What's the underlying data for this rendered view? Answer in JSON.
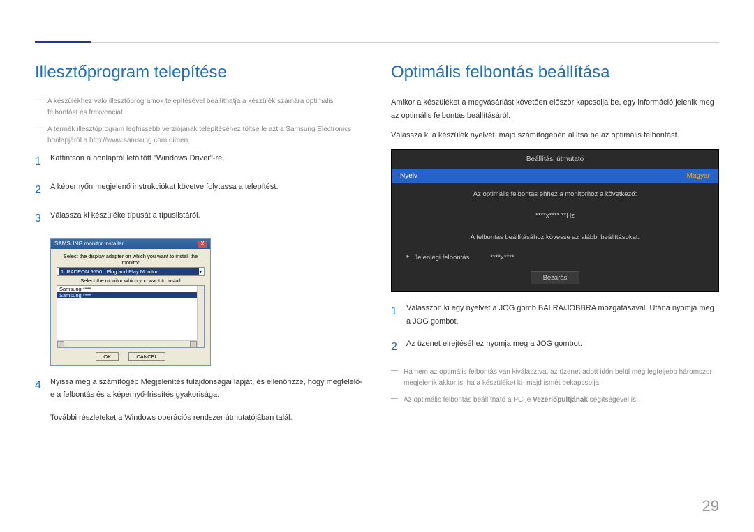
{
  "pageNumber": "29",
  "left": {
    "heading": "Illesztőprogram telepítése",
    "notes": [
      "A készülékhez való illesztőprogramok telepítésével beállíthatja a készülék számára optimális felbontást és frekvenciát.",
      "A termék illesztőprogram legfrissebb verziójának telepítéséhez töltse le azt a Samsung Electronics honlapjáról a http://www.samsung.com címen."
    ],
    "steps": [
      "Kattintson a honlapról letöltött \"Windows Driver\"-re.",
      "A képernyőn megjelenő instrukciókat követve folytassa a telepítést.",
      "Válassza ki készüléke típusát a típuslistáról."
    ],
    "installer": {
      "title": "SAMSUNG monitor installer",
      "label1": "Select the display adapter on which you want to install the monitor",
      "adapter": "1. RADEON 9550 : Plug and Play Monitor",
      "label2": "Select the monitor which you want to install",
      "list": [
        "Samsung ****",
        "Samsung ****"
      ],
      "ok": "OK",
      "cancel": "CANCEL"
    },
    "step4": "Nyissa meg a számítógép Megjelenítés tulajdonságai lapját, és ellenőrizze, hogy megfelelő-e a felbontás és a képernyő-frissítés gyakorisága.",
    "step4b": "További részleteket a Windows operációs rendszer útmutatójában talál."
  },
  "right": {
    "heading": "Optimális felbontás beállítása",
    "para1": "Amikor a készüléket a megvásárlást követően először kapcsolja be, egy információ jelenik meg az optimális felbontás beállításáról.",
    "para2": "Válassza ki a készülék nyelvét, majd számítógépén állítsa be az optimális felbontást.",
    "osd": {
      "title": "Beállítási útmutató",
      "langLabel": "Nyelv",
      "langValue": "Magyar",
      "line1": "Az optimális felbontás ehhez a monitorhoz a következő:",
      "line2": "****x**** **Hz",
      "line3": "A felbontás beállításához kövesse az alábbi beállításokat.",
      "currentLabel": "Jelenlegi felbontás",
      "currentValue": "****x****",
      "close": "Bezárás"
    },
    "rsteps": [
      "Válasszon ki egy nyelvet a JOG gomb BALRA/JOBBRA mozgatásával. Utána nyomja meg a JOG gombot.",
      "Az üzenet elrejtéséhez nyomja meg a JOG gombot."
    ],
    "rnotes": [
      "Ha nem az optimális felbontás van kiválasztva, az üzenet adott időn belül még legfeljebb háromszor megjelenik akkor is, ha a készüléket ki- majd ismét bekapcsolja."
    ],
    "rnote2_pre": "Az optimális felbontás beállítható a PC-je ",
    "rnote2_strong": "Vezérlőpultjának",
    "rnote2_post": " segítségével is."
  }
}
